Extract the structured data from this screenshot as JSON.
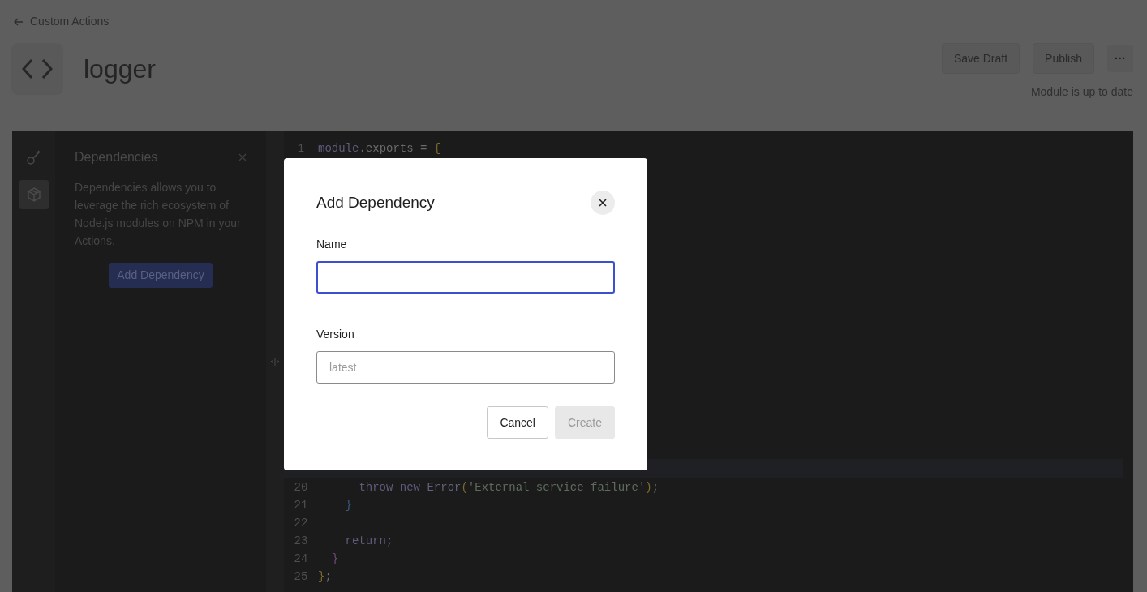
{
  "breadcrumb": {
    "label": "Custom Actions"
  },
  "header": {
    "title": "logger",
    "buttons": [
      {
        "label": "Save Draft",
        "kind": "text"
      },
      {
        "label": "Publish",
        "kind": "text"
      },
      {
        "label": "···",
        "kind": "more"
      }
    ],
    "status": "Module is up to date"
  },
  "editor": {
    "rail": [
      {
        "kind": "key",
        "selected": false
      },
      {
        "kind": "package",
        "selected": true
      }
    ],
    "panel": {
      "title": "Dependencies",
      "description": "Dependencies allows you to leverage the rich ecosystem of Node.js modules on NPM in your Actions.",
      "button": "Add Dependency"
    },
    "code_top": [
      {
        "number": "1",
        "tokens": [
          {
            "text": "module",
            "kind": "keyword"
          },
          {
            "text": ".exports = ",
            "kind": "plain"
          },
          {
            "text": "{",
            "kind": "bracket1"
          }
        ]
      }
    ],
    "code_bottom": [
      {
        "number": "20",
        "tokens": [
          {
            "text": "      throw new ",
            "kind": "keyword"
          },
          {
            "text": "Error",
            "kind": "type"
          },
          {
            "text": "(",
            "kind": "bracket1"
          },
          {
            "text": "'External service failure'",
            "kind": "string"
          },
          {
            "text": ")",
            "kind": "bracket1"
          },
          {
            "text": ";",
            "kind": "plain"
          }
        ]
      },
      {
        "number": "21",
        "tokens": [
          {
            "text": "    }",
            "kind": "bracket2"
          }
        ]
      },
      {
        "number": "22"
      },
      {
        "number": "23",
        "tokens": [
          {
            "text": "    return",
            "kind": "keyword"
          },
          {
            "text": ";",
            "kind": "plain"
          }
        ]
      },
      {
        "number": "24",
        "tokens": [
          {
            "text": "  }",
            "kind": "bracket3"
          }
        ]
      },
      {
        "number": "25",
        "tokens": [
          {
            "text": "}",
            "kind": "bracket1"
          },
          {
            "text": ";",
            "kind": "plain"
          }
        ]
      }
    ]
  },
  "dialog": {
    "title": "Add Dependency",
    "fields": [
      {
        "label": "Name",
        "focused": true
      },
      {
        "label": "Version",
        "placeholder": "latest",
        "focused": false
      }
    ],
    "buttons": [
      {
        "label": "Cancel",
        "disabled": false
      },
      {
        "label": "Create",
        "disabled": true
      }
    ]
  }
}
